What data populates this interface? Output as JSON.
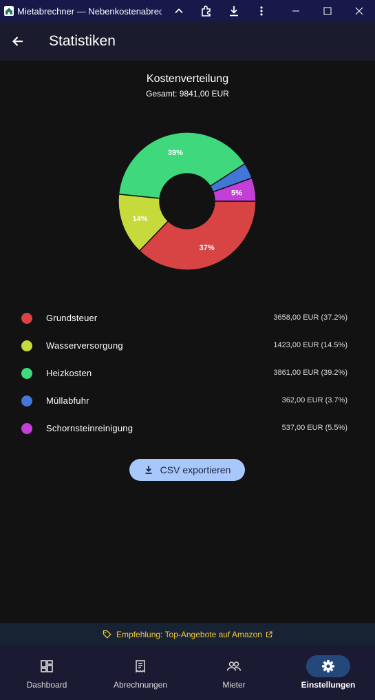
{
  "window": {
    "title": "Mietabrechner — Nebenkostenabrec..."
  },
  "appbar": {
    "title": "Statistiken"
  },
  "chart_data": {
    "type": "pie",
    "title": "Kostenverteilung",
    "subtitle": "Gesamt: 9841,00 EUR",
    "categories": [
      "Grundsteuer",
      "Wasserversorgung",
      "Heizkosten",
      "Müllabfuhr",
      "Schornsteinreinigung"
    ],
    "values": [
      3658.0,
      1423.0,
      3861.0,
      362.0,
      537.0
    ],
    "colors": [
      "#d84443",
      "#c6da3c",
      "#3fd87c",
      "#4277d8",
      "#c43fd8"
    ],
    "slice_labels": [
      "37%",
      "14%",
      "39%",
      "",
      "5%"
    ]
  },
  "legend": [
    {
      "name": "Grundsteuer",
      "value": "3658,00 EUR (37.2%)",
      "color": "#d84443"
    },
    {
      "name": "Wasserversorgung",
      "value": "1423,00 EUR (14.5%)",
      "color": "#c6da3c"
    },
    {
      "name": "Heizkosten",
      "value": "3861,00 EUR (39.2%)",
      "color": "#3fd87c"
    },
    {
      "name": "Müllabfuhr",
      "value": "362,00 EUR (3.7%)",
      "color": "#4277d8"
    },
    {
      "name": "Schornsteinreinigung",
      "value": "537,00 EUR (5.5%)",
      "color": "#c43fd8"
    }
  ],
  "actions": {
    "csv_label": "CSV exportieren"
  },
  "promo": {
    "text": "Empfehlung: Top-Angebote auf Amazon"
  },
  "nav": [
    {
      "label": "Dashboard",
      "icon": "dashboard-icon"
    },
    {
      "label": "Abrechnungen",
      "icon": "receipt-icon"
    },
    {
      "label": "Mieter",
      "icon": "people-icon"
    },
    {
      "label": "Einstellungen",
      "icon": "gear-icon",
      "active": true
    }
  ]
}
